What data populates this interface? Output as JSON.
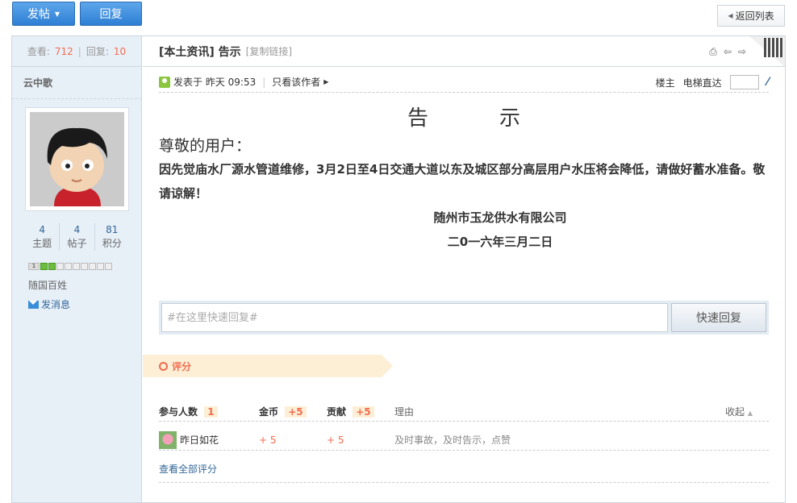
{
  "toolbar": {
    "post_label": "发帖",
    "reply_label": "回复",
    "back_label": "返回列表"
  },
  "sidebar": {
    "views_label": "查看:",
    "views": "712",
    "replies_label": "回复:",
    "replies": "10",
    "username": "云中歌",
    "counts": [
      {
        "value": "4",
        "label": "主题"
      },
      {
        "value": "4",
        "label": "帖子"
      },
      {
        "value": "81",
        "label": "积分"
      }
    ],
    "level_number": "1",
    "group": "随国百姓",
    "send_message": "发消息"
  },
  "thread": {
    "title": "[本土资讯] 告示",
    "copy_link": "[复制链接]"
  },
  "meta": {
    "posted": "发表于 昨天 09:53",
    "author_only": "只看该作者",
    "floor": "楼主",
    "jump": "电梯直达"
  },
  "post": {
    "heading": "告示",
    "greeting": "尊敬的用户：",
    "body": "因先觉庙水厂源水管道维修，3月2日至4日交通大道以东及城区部分高层用户水压将会降低，请做好蓄水准备。敬请谅解！",
    "company": "随州市玉龙供水有限公司",
    "date": "二0一六年三月二日"
  },
  "quick_reply": {
    "placeholder": "#在这里快速回复#",
    "button": "快速回复"
  },
  "rating": {
    "banner": "评分",
    "participants_label": "参与人数",
    "participants": "1",
    "coins_label": "金币",
    "coins_total": "+5",
    "contrib_label": "贡献",
    "contrib_total": "+5",
    "reason_label": "理由",
    "collapse": "收起",
    "rows": [
      {
        "user": "昨日如花",
        "coins": "+ 5",
        "contrib": "+ 5",
        "reason": "及时事故，及时告示，点赞"
      }
    ],
    "view_all": "查看全部评分"
  },
  "colors": {
    "accent": "#f26c4f",
    "link": "#336699",
    "sidebar_bg": "#e7eff7",
    "primary_button": "#2d7fd4"
  }
}
